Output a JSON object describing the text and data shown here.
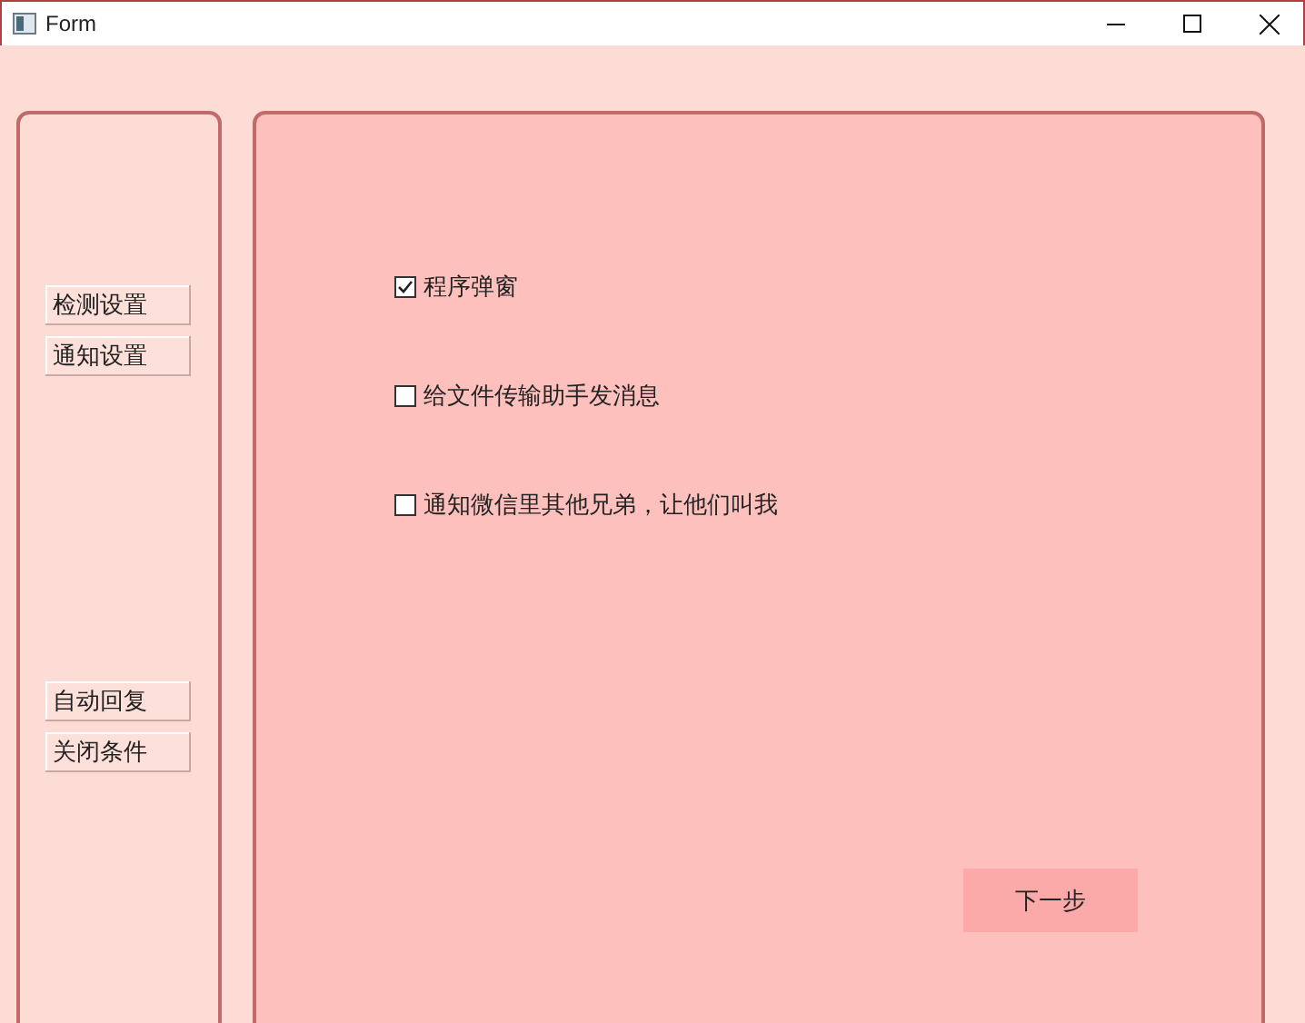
{
  "window": {
    "title": "Form"
  },
  "sidebar": {
    "groups": [
      [
        {
          "label": "检测设置"
        },
        {
          "label": "通知设置"
        }
      ],
      [
        {
          "label": "自动回复"
        },
        {
          "label": "关闭条件"
        }
      ]
    ]
  },
  "options": [
    {
      "label": "程序弹窗",
      "checked": true
    },
    {
      "label": "给文件传输助手发消息",
      "checked": false
    },
    {
      "label": "通知微信里其他兄弟，让他们叫我",
      "checked": false
    }
  ],
  "next_button": {
    "label": "下一步"
  }
}
